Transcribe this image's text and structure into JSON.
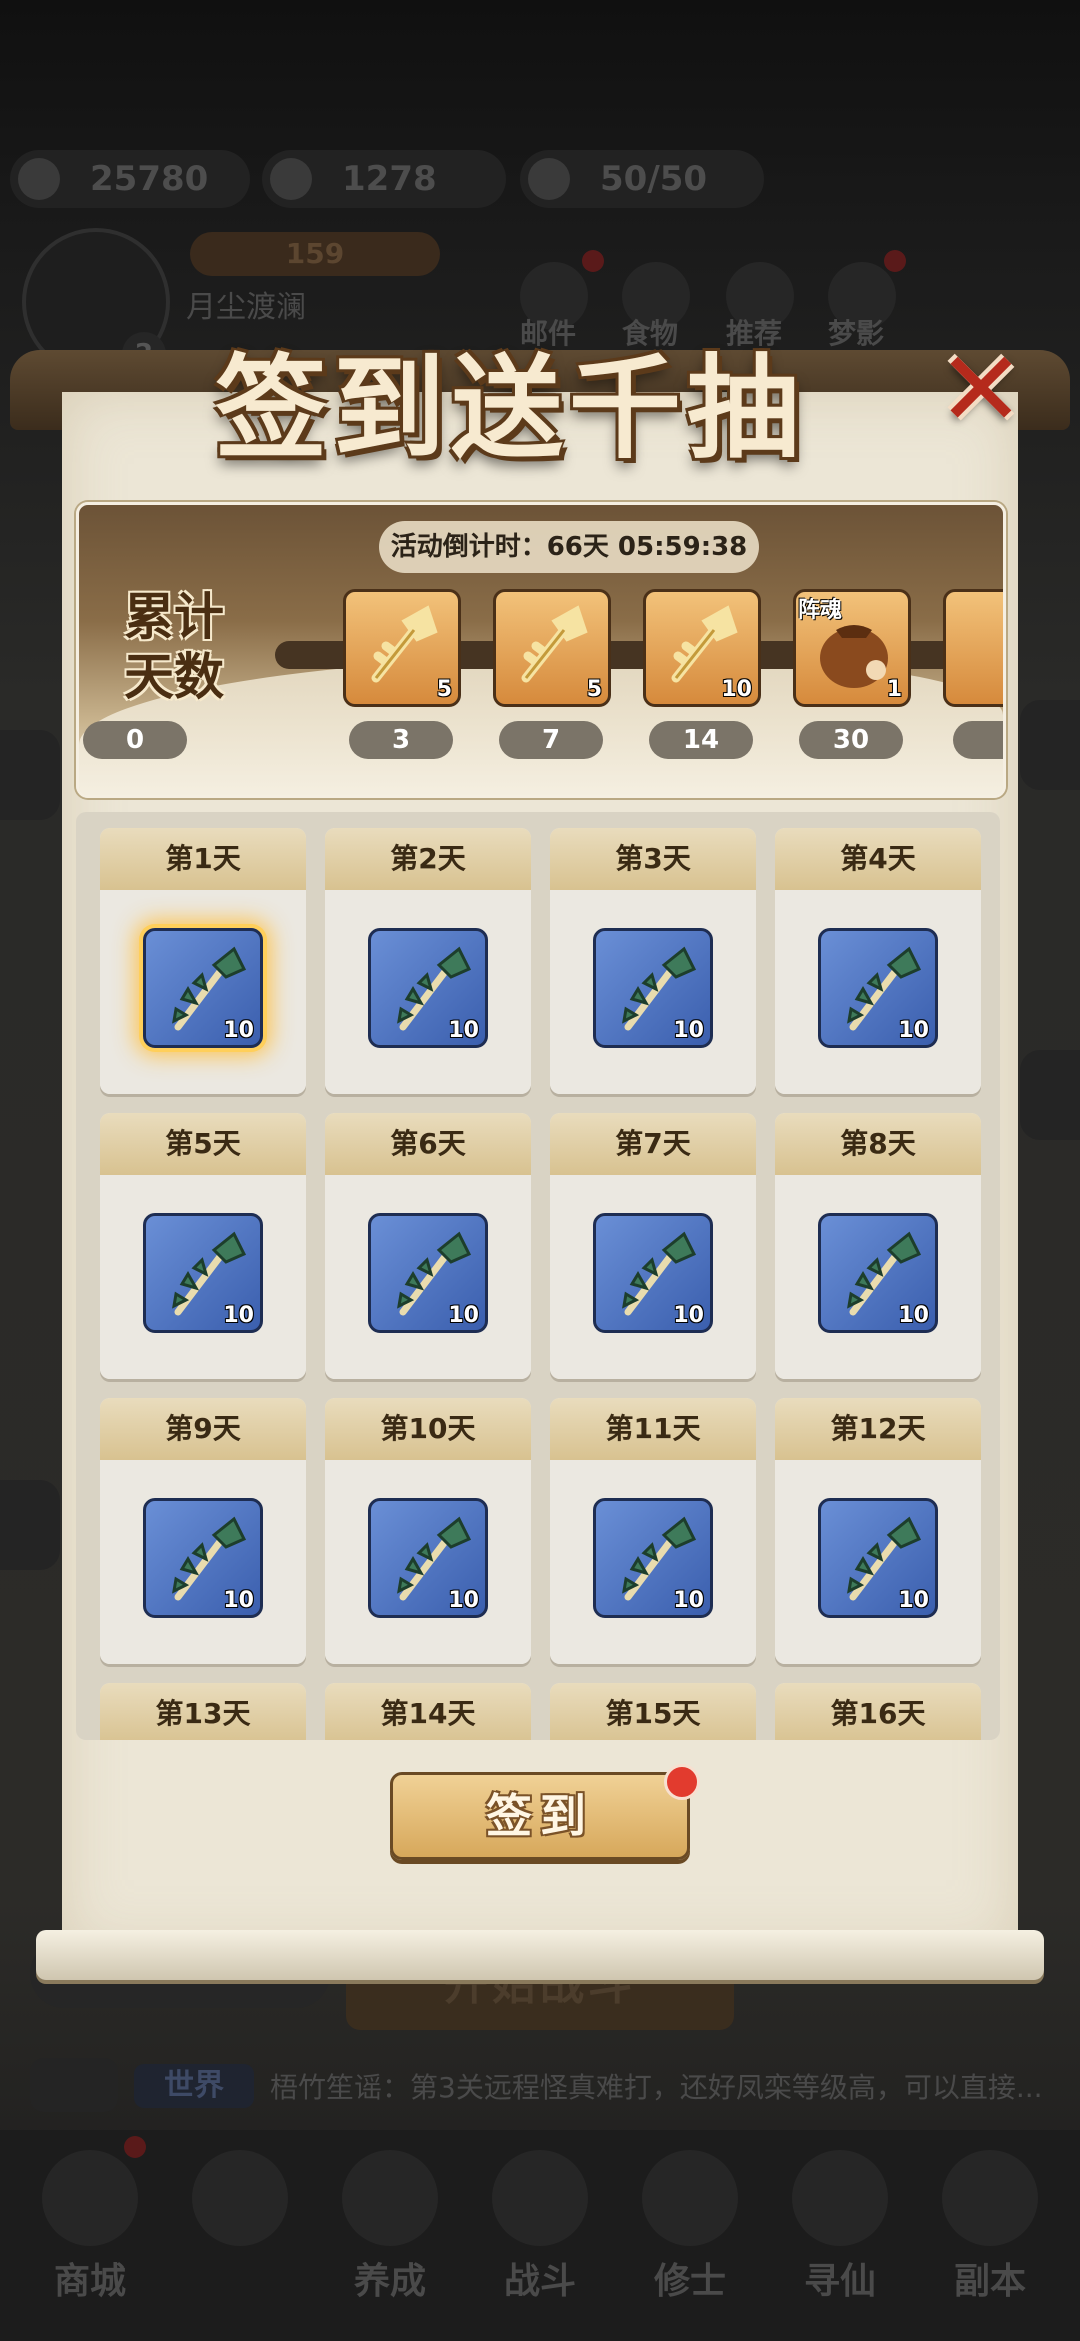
{
  "background": {
    "resources": [
      {
        "icon": "coin-icon",
        "value": "25780"
      },
      {
        "icon": "ticket-icon",
        "value": "1278"
      },
      {
        "icon": "stamina-icon",
        "value": "50/50"
      }
    ],
    "player": {
      "name": "月尘渡澜",
      "level": "2",
      "power": "159"
    },
    "top_icons": [
      "邮件",
      "食物",
      "推荐",
      "梦影"
    ],
    "start_battle": "开始战斗",
    "chat": {
      "channel": "世界",
      "text": "梧竹笙谣：第3关远程怪真难打，还好凤栾等级高，可以直接..."
    },
    "nav": [
      "商城",
      "",
      "养成",
      "战斗",
      "修士",
      "寻仙",
      "副本"
    ]
  },
  "modal": {
    "title": "签到送千抽",
    "close_icon": "close-icon",
    "countdown": "活动倒计时：66天 05:59:38",
    "cumulative_label": "累计天数",
    "milestones": [
      {
        "day": "0",
        "qty": "",
        "tag": "",
        "icon": ""
      },
      {
        "day": "3",
        "qty": "5",
        "tag": "",
        "icon": "gold-key-icon"
      },
      {
        "day": "7",
        "qty": "5",
        "tag": "",
        "icon": "gold-key-icon"
      },
      {
        "day": "14",
        "qty": "10",
        "tag": "",
        "icon": "gold-key-icon"
      },
      {
        "day": "30",
        "qty": "1",
        "tag": "阵魂",
        "icon": "pouch-icon"
      }
    ],
    "days": [
      {
        "label": "第1天",
        "qty": "10"
      },
      {
        "label": "第2天",
        "qty": "10"
      },
      {
        "label": "第3天",
        "qty": "10"
      },
      {
        "label": "第4天",
        "qty": "10"
      },
      {
        "label": "第5天",
        "qty": "10"
      },
      {
        "label": "第6天",
        "qty": "10"
      },
      {
        "label": "第7天",
        "qty": "10"
      },
      {
        "label": "第8天",
        "qty": "10"
      },
      {
        "label": "第9天",
        "qty": "10"
      },
      {
        "label": "第10天",
        "qty": "10"
      },
      {
        "label": "第11天",
        "qty": "10"
      },
      {
        "label": "第12天",
        "qty": "10"
      },
      {
        "label": "第13天",
        "qty": ""
      },
      {
        "label": "第14天",
        "qty": ""
      },
      {
        "label": "第15天",
        "qty": ""
      },
      {
        "label": "第16天",
        "qty": ""
      }
    ],
    "day_item_icon": "jade-key-icon",
    "highlighted_day": "第1天",
    "signin_button": "签到",
    "colors": {
      "accent": "#d7a85b",
      "highlight": "#ffcf5a",
      "badge": "#e23b2e"
    }
  }
}
